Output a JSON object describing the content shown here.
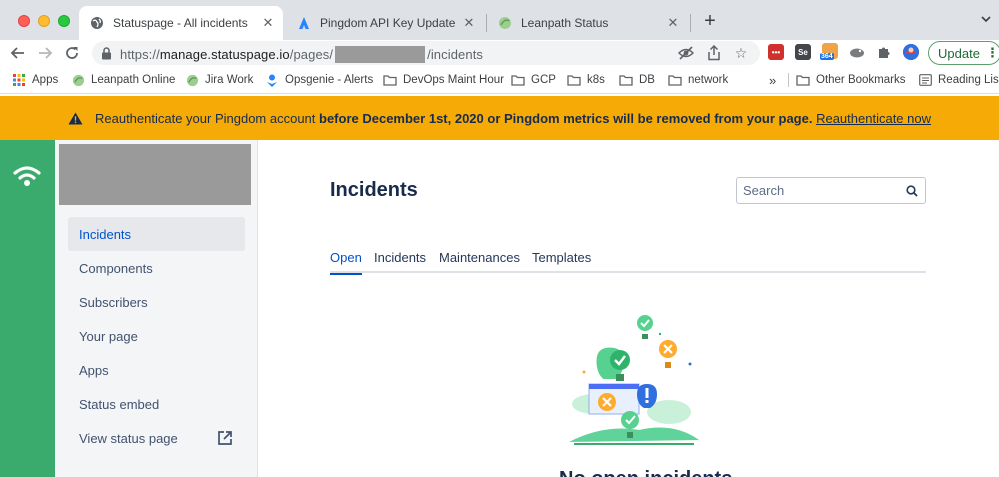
{
  "browser": {
    "tabs": [
      {
        "title": "Statuspage - All incidents",
        "active": true
      },
      {
        "title": "Pingdom API Key Update",
        "active": false
      },
      {
        "title": "Leanpath Status",
        "active": false
      }
    ],
    "url": {
      "prefix": "https://",
      "host": "manage.statuspage.io",
      "pre_path": "/pages/",
      "post_path": "/incidents"
    },
    "update_label": "Update",
    "bookmarks": [
      {
        "label": "Apps",
        "icon": "apps-grid-icon"
      },
      {
        "label": "Leanpath Online",
        "icon": "leanpath-icon"
      },
      {
        "label": "Jira Work",
        "icon": "leanpath-icon"
      },
      {
        "label": "Opsgenie - Alerts",
        "icon": "opsgenie-icon"
      },
      {
        "label": "DevOps Maint Hour",
        "icon": "folder-icon"
      },
      {
        "label": "GCP",
        "icon": "folder-icon"
      },
      {
        "label": "k8s",
        "icon": "folder-icon"
      },
      {
        "label": "DB",
        "icon": "folder-icon"
      },
      {
        "label": "network",
        "icon": "folder-icon"
      }
    ],
    "overflow": "»",
    "other_bookmarks": "Other Bookmarks",
    "reading_list": "Reading List",
    "extension_badge": "364"
  },
  "banner": {
    "text_start": "Reauthenticate your Pingdom account ",
    "text_bold": "before December 1st, 2020 or Pingdom metrics will be removed from your page.",
    "link": "Reauthenticate now",
    "color": "#f6aa06"
  },
  "sidebar": {
    "items": [
      {
        "label": "Incidents",
        "active": true
      },
      {
        "label": "Components"
      },
      {
        "label": "Subscribers"
      },
      {
        "label": "Your page"
      },
      {
        "label": "Apps"
      },
      {
        "label": "Status embed"
      },
      {
        "label": "View status page"
      }
    ],
    "accent": "#3aab6d"
  },
  "main": {
    "title": "Incidents",
    "search_placeholder": "Search",
    "tabs": [
      {
        "label": "Open",
        "active": true
      },
      {
        "label": "Incidents"
      },
      {
        "label": "Maintenances"
      },
      {
        "label": "Templates"
      }
    ],
    "empty_title": "No open incidents"
  }
}
